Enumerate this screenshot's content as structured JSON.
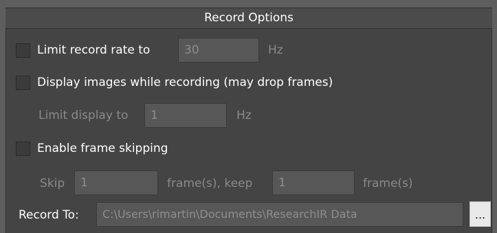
{
  "header": {
    "title": "Record Options"
  },
  "limit_rate": {
    "label": "Limit record rate to",
    "value": "30",
    "unit": "Hz",
    "checked": false
  },
  "display_images": {
    "label": "Display images while recording (may drop frames)",
    "checked": false
  },
  "limit_display": {
    "label": "Limit display to",
    "value": "1",
    "unit": "Hz"
  },
  "frame_skipping": {
    "label": "Enable frame skipping",
    "checked": false
  },
  "skip": {
    "label": "Skip",
    "value": "1",
    "mid_label": "frame(s), keep",
    "keep_value": "1",
    "end_label": "frame(s)"
  },
  "record_to": {
    "label": "Record To:",
    "path": "C:\\Users\\rimartin\\Documents\\ResearchIR Data",
    "browse_label": "..."
  }
}
